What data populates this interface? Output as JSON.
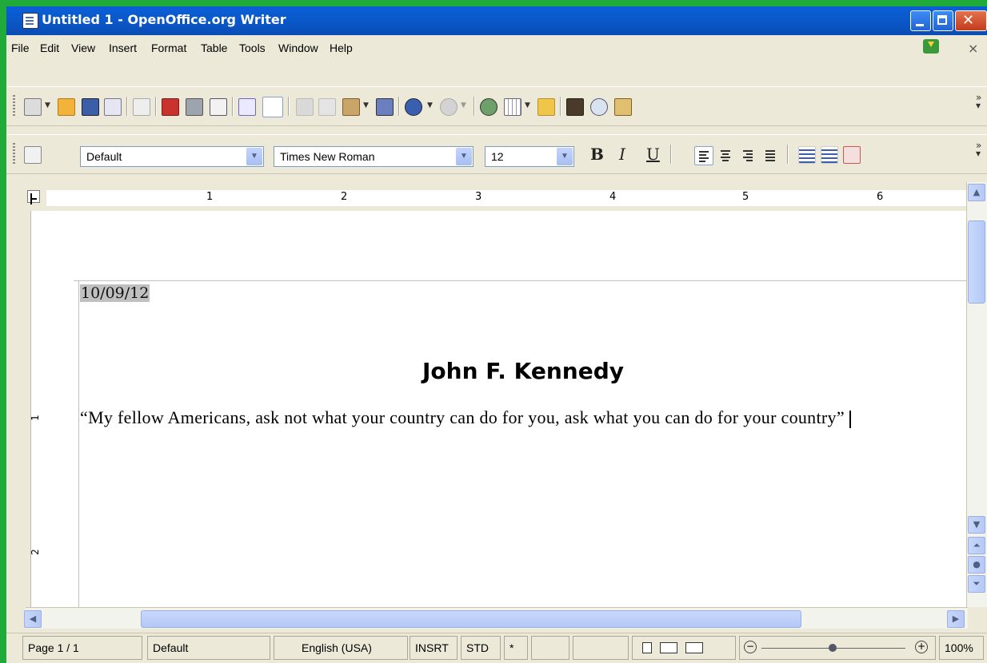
{
  "window": {
    "title": "Untitled 1 - OpenOffice.org Writer"
  },
  "menu": {
    "items": [
      "File",
      "Edit",
      "View",
      "Insert",
      "Format",
      "Table",
      "Tools",
      "Window",
      "Help"
    ],
    "close_glyph": "×"
  },
  "formatting": {
    "paragraph_style": "Default",
    "font_name": "Times New Roman",
    "font_size": "12",
    "bold": "B",
    "italic": "I",
    "underline": "U"
  },
  "ruler": {
    "numbers": [
      "1",
      "2",
      "3",
      "4",
      "5",
      "6"
    ],
    "vertical_numbers": [
      "1",
      "2"
    ]
  },
  "document": {
    "date": "10/09/12",
    "heading": "John F. Kennedy",
    "quote": "“My fellow Americans, ask not what your country can do for you, ask what you can do for your country”"
  },
  "status": {
    "page": "Page 1 / 1",
    "style": "Default",
    "language": "English (USA)",
    "insert_mode": "INSRT",
    "selection_mode": "STD",
    "modified": "*",
    "zoom": "100%"
  },
  "colors": {
    "titlebar": "#0a5fd8",
    "desktop": "#1faa3a",
    "chrome": "#ece9d8"
  },
  "icons": [
    "new-document-icon",
    "open-folder-icon",
    "save-icon",
    "email-icon",
    "edit-file-icon",
    "export-pdf-icon",
    "print-icon",
    "page-preview-icon",
    "spellcheck-icon",
    "autospellcheck-icon",
    "cut-icon",
    "copy-icon",
    "paste-icon",
    "format-paintbrush-icon",
    "undo-icon",
    "redo-icon",
    "hyperlink-icon",
    "table-icon",
    "draw-functions-icon",
    "find-replace-icon",
    "navigator-icon",
    "gallery-icon"
  ]
}
